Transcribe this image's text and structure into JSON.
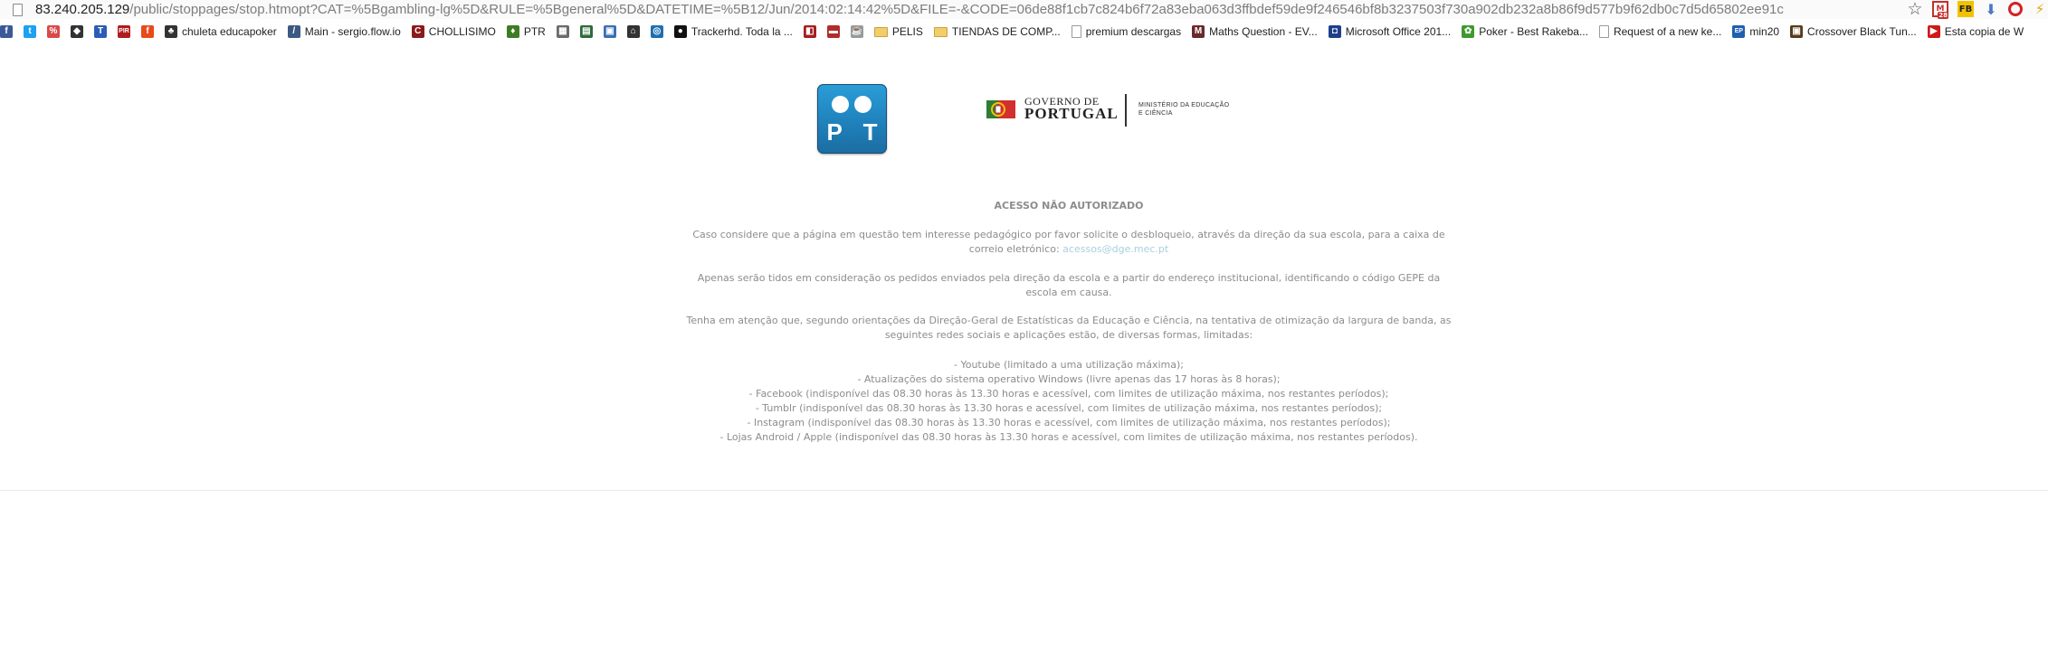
{
  "browser": {
    "url_host": "83.240.205.129",
    "url_path": "/public/stoppages/stop.htmopt?CAT=%5Bgambling-lg%5D&RULE=%5Bgeneral%5D&DATETIME=%5B12/Jun/2014:02:14:42%5D&FILE=-&CODE=06de88f1cb7c824b6f72a83eba063d3ffbdef59de9f246546bf8b3237503f730a902db232a8b86f9d577b9f62db0c7d5d65802ee91c",
    "gmail_count": "28",
    "fb_ext_label": "FB",
    "bookmarks": [
      {
        "label": "",
        "icon": "facebook-icon",
        "color": "#3b5998",
        "glyph": "f"
      },
      {
        "label": "",
        "icon": "twitter-icon",
        "color": "#1da1f2",
        "glyph": "t"
      },
      {
        "label": "",
        "icon": "percent-icon",
        "color": "#d84a4a",
        "glyph": "%"
      },
      {
        "label": "",
        "icon": "graduation-icon",
        "color": "#333333",
        "glyph": "◆"
      },
      {
        "label": "",
        "icon": "trello-icon",
        "color": "#2b5db8",
        "glyph": "T"
      },
      {
        "label": "",
        "icon": "pir-icon",
        "color": "#b01c1c",
        "glyph": "PIR"
      },
      {
        "label": "",
        "icon": "bookmark-red-icon",
        "color": "#e84a1a",
        "glyph": "f"
      },
      {
        "label": "chuleta educapoker",
        "icon": "educapoker-icon",
        "color": "#333333",
        "glyph": "♣"
      },
      {
        "label": "Main - sergio.flow.io",
        "icon": "flow-icon",
        "color": "#3c5a80",
        "glyph": "/"
      },
      {
        "label": "CHOLLISIMO",
        "icon": "chollisimo-icon",
        "color": "#8b1a1a",
        "glyph": "C"
      },
      {
        "label": "PTR",
        "icon": "ptr-icon",
        "color": "#3e7c24",
        "glyph": "♦"
      },
      {
        "label": "",
        "icon": "chart-icon",
        "color": "#6a6a6a",
        "glyph": "▦"
      },
      {
        "label": "",
        "icon": "grid-icon",
        "color": "#2e6b3a",
        "glyph": "▤"
      },
      {
        "label": "",
        "icon": "image-icon",
        "color": "#3a6fb5",
        "glyph": "▣"
      },
      {
        "label": "",
        "icon": "bank-icon",
        "color": "#333333",
        "glyph": "⌂"
      },
      {
        "label": "",
        "icon": "camera-icon",
        "color": "#1f6fb0",
        "glyph": "◎"
      },
      {
        "label": "Trackerhd. Toda la ...",
        "icon": "trackerhd-icon",
        "color": "#111111",
        "glyph": "●"
      },
      {
        "label": "",
        "icon": "ms-icon",
        "color": "#a32020",
        "glyph": "◧"
      },
      {
        "label": "",
        "icon": "pdf-icon",
        "color": "#b32b2b",
        "glyph": "▬"
      },
      {
        "label": "",
        "icon": "cup-icon",
        "color": "#999999",
        "glyph": "☕"
      },
      {
        "label": "PELIS",
        "icon": "folder-icon",
        "color": "#f3cd6a",
        "glyph": ""
      },
      {
        "label": "TIENDAS DE COMP...",
        "icon": "folder-icon",
        "color": "#f3cd6a",
        "glyph": ""
      },
      {
        "label": "premium descargas",
        "icon": "page-icon",
        "color": "#ffffff",
        "glyph": ""
      },
      {
        "label": "Maths Question - EV...",
        "icon": "maths-icon",
        "color": "#6a2a2a",
        "glyph": "M"
      },
      {
        "label": "Microsoft Office 201...",
        "icon": "office-icon",
        "color": "#1f3f8a",
        "glyph": "◘"
      },
      {
        "label": "Poker - Best Rakeba...",
        "icon": "poker-icon",
        "color": "#3e9a2c",
        "glyph": "✿"
      },
      {
        "label": "Request of a new ke...",
        "icon": "page-icon",
        "color": "#ffffff",
        "glyph": ""
      },
      {
        "label": "min20",
        "icon": "ep-icon",
        "color": "#1f5fb0",
        "glyph": "EP"
      },
      {
        "label": "Crossover Black Tun...",
        "icon": "crossover-icon",
        "color": "#5a3a1a",
        "glyph": "▣"
      },
      {
        "label": "Esta copia de W",
        "icon": "youtube-icon",
        "color": "#cc1a1a",
        "glyph": "▶"
      }
    ]
  },
  "content": {
    "logo_pt_text": "P T",
    "gov_line1": "GOVERNO DE",
    "gov_line2": "PORTUGAL",
    "gov_ministry_l1": "MINISTÉRIO DA EDUCAÇÃO",
    "gov_ministry_l2": "E CIÊNCIA",
    "title": "ACESSO NÃO AUTORIZADO",
    "p1_line1": "Caso considere que a página em questão tem interesse pedagógico por favor solicite o desbloqueio, através da direção da sua escola, para a caixa de",
    "p1_line2": "correio eletrónico: ",
    "email": "acessos@dge.mec.pt",
    "p2_line1": "Apenas serão tidos em consideração os pedidos enviados pela direção da escola e a partir do endereço institucional, identificando o código GEPE da",
    "p2_line2": "escola em causa.",
    "p3_line1": "Tenha em atenção que, segundo orientações da Direção-Geral de Estatísticas da Educação e Ciência, na tentativa de otimização da largura de banda, as",
    "p3_line2": "seguintes redes sociais e aplicações estão, de diversas formas, limitadas:",
    "limits": [
      "- Youtube (limitado a uma utilização máxima);",
      "- Atualizações do sistema operativo Windows (livre apenas das 17 horas às 8 horas);",
      "- Facebook (indisponível das 08.30 horas às 13.30 horas e acessível, com limites de utilização máxima, nos restantes períodos);",
      "- Tumblr (indisponível das 08.30 horas às 13.30 horas e acessível, com limites de utilização máxima, nos restantes períodos);",
      "- Instagram (indisponível das 08.30 horas às 13.30 horas e acessível, com limites de utilização máxima, nos restantes períodos);",
      "- Lojas Android / Apple (indisponível das 08.30 horas às 13.30 horas e acessível, com limites de utilização máxima, nos restantes períodos)."
    ]
  }
}
